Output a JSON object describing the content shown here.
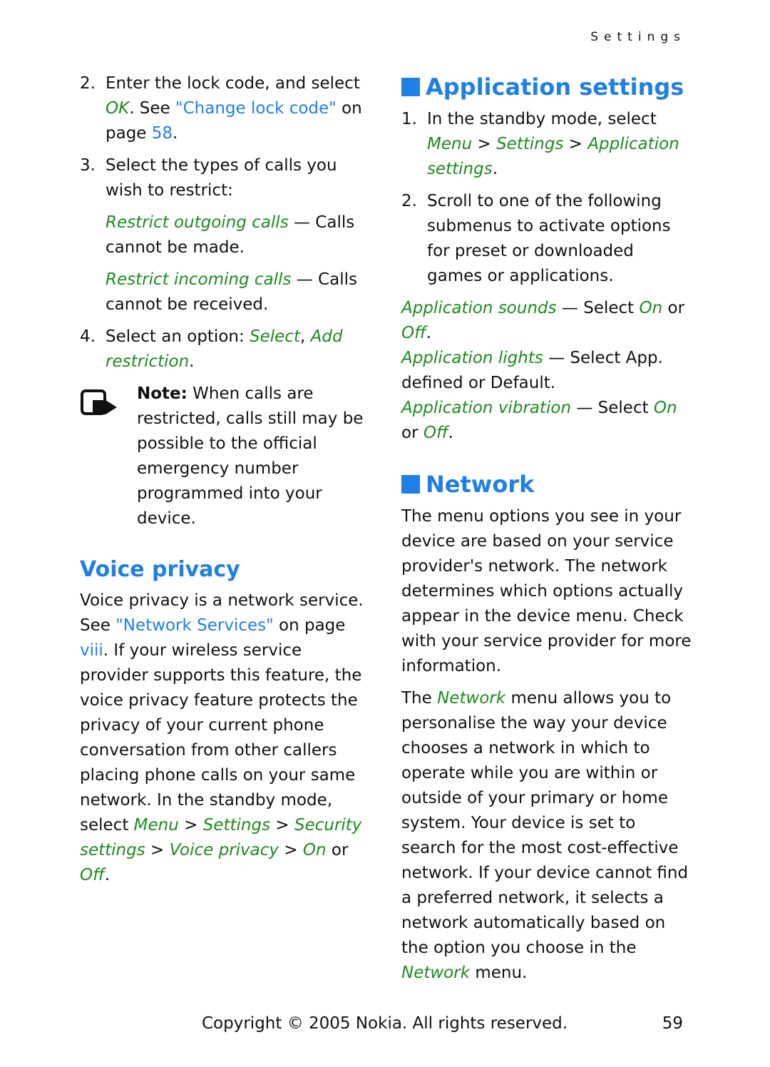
{
  "header": {
    "running_title": "Settings"
  },
  "left": {
    "step2": {
      "num": "2.",
      "t1": "Enter the lock code, and select ",
      "ok": "OK",
      "t2": ". See ",
      "link": "\"Change lock code\"",
      "t3": " on page ",
      "page": "58",
      "t4": "."
    },
    "step3": {
      "num": "3.",
      "text": "Select the types of calls you wish to restrict:"
    },
    "opt_out": {
      "label": "Restrict outgoing calls",
      "desc": " — Calls cannot be made."
    },
    "opt_in": {
      "label": "Restrict incoming calls",
      "desc": " — Calls cannot be received."
    },
    "step4": {
      "num": "4.",
      "t1": "Select an option: ",
      "o1": "Select",
      "sep": ", ",
      "o2": "Add restriction",
      "t2": "."
    },
    "note": {
      "label": "Note:",
      "text": " When calls are restricted, calls still may be possible to the official emergency number programmed into your device."
    },
    "voice": {
      "heading": "Voice privacy",
      "t1": "Voice privacy is a network service. See ",
      "link": "\"Network Services\"",
      "t2": " on page ",
      "page": "viii",
      "t3": ". If your wireless service provider supports this feature, the voice privacy feature protects the privacy of your current phone conversation from other callers placing phone calls on your same network. In the standby mode, select ",
      "m1": "Menu",
      "gt": " > ",
      "m2": "Settings",
      "m3": "Security settings",
      "m4": "Voice privacy",
      "on": "On",
      "or": " or ",
      "off": "Off",
      "end": "."
    }
  },
  "right": {
    "app": {
      "heading": "Application settings",
      "step1": {
        "num": "1.",
        "t1": "In the standby mode, select ",
        "m1": "Menu",
        "gt": " > ",
        "m2": "Settings",
        "m3": "Application settings",
        "end": "."
      },
      "step2": {
        "num": "2.",
        "text": "Scroll to one of the following submenus to activate options for preset or downloaded games or applications."
      },
      "sounds": {
        "label": "Application sounds",
        "t1": " — Select ",
        "on": "On",
        "or": " or ",
        "off": "Off",
        "end": "."
      },
      "lights": {
        "label": "Application lights",
        "desc": " — Select App. defined or Default."
      },
      "vibration": {
        "label": "Application vibration",
        "t1": " — Select ",
        "on": "On",
        "or": " or ",
        "off": "Off",
        "end": "."
      }
    },
    "network": {
      "heading": "Network",
      "p1": "The menu options you see in your device are based on your service provider's network. The network determines which options actually appear in the device menu. Check with your service provider for more information.",
      "p2a": "The ",
      "p2menu": "Network",
      "p2b": " menu allows you to personalise the way your device chooses a network in which to operate while you are within or outside of your primary or home system. Your device is set to search for the most cost-effective network. If your device cannot find a preferred network, it selects a network automatically based on the option you choose in the ",
      "p2menu2": "Network",
      "p2c": " menu."
    }
  },
  "footer": {
    "copyright": "Copyright © 2005 Nokia. All rights reserved.",
    "page_number": "59"
  }
}
